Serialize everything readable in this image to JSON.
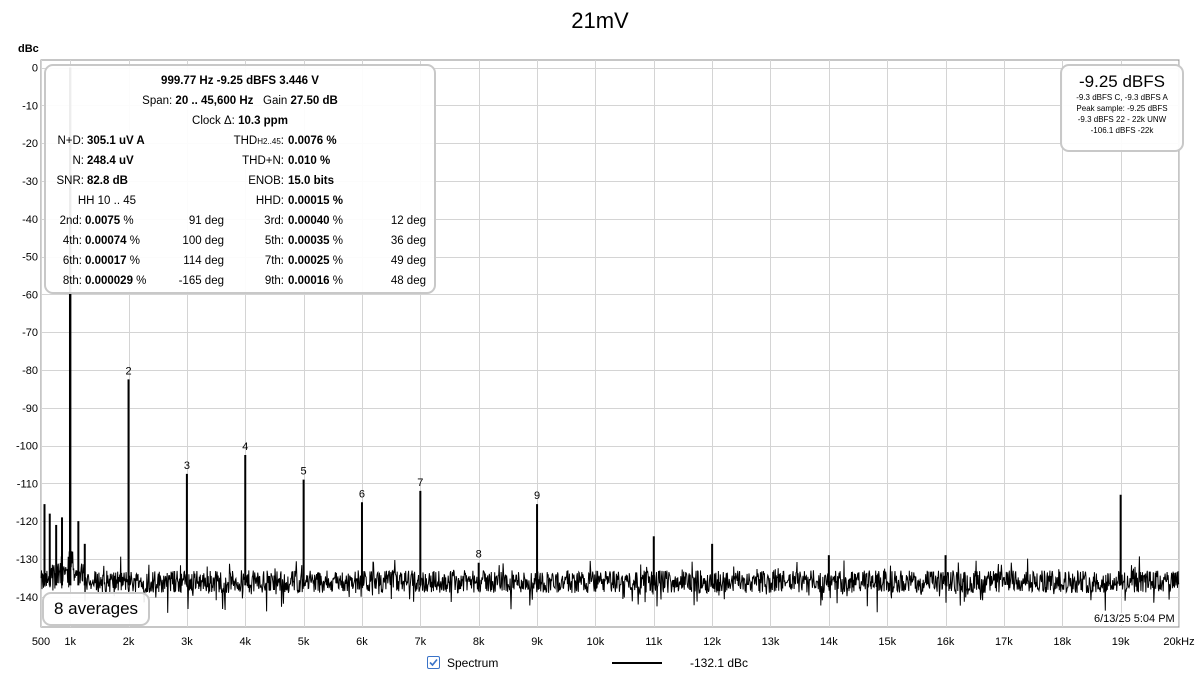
{
  "chart_data": {
    "type": "line",
    "title": "21mV",
    "ylabel": "dBc",
    "xlim": [
      500,
      20000
    ],
    "ylim": [
      -148,
      2
    ],
    "x_ticks": [
      {
        "value": 500,
        "label": "500"
      },
      {
        "value": 1000,
        "label": "1k"
      },
      {
        "value": 2000,
        "label": "2k"
      },
      {
        "value": 3000,
        "label": "3k"
      },
      {
        "value": 4000,
        "label": "4k"
      },
      {
        "value": 5000,
        "label": "5k"
      },
      {
        "value": 6000,
        "label": "6k"
      },
      {
        "value": 7000,
        "label": "7k"
      },
      {
        "value": 8000,
        "label": "8k"
      },
      {
        "value": 9000,
        "label": "9k"
      },
      {
        "value": 10000,
        "label": "10k"
      },
      {
        "value": 11000,
        "label": "11k"
      },
      {
        "value": 12000,
        "label": "12k"
      },
      {
        "value": 13000,
        "label": "13k"
      },
      {
        "value": 14000,
        "label": "14k"
      },
      {
        "value": 15000,
        "label": "15k"
      },
      {
        "value": 16000,
        "label": "16k"
      },
      {
        "value": 17000,
        "label": "17k"
      },
      {
        "value": 18000,
        "label": "18k"
      },
      {
        "value": 19000,
        "label": "19k"
      },
      {
        "value": 20000,
        "label": "20kHz"
      }
    ],
    "y_ticks": [
      {
        "value": 0,
        "label": "0"
      },
      {
        "value": -10,
        "label": "-10"
      },
      {
        "value": -20,
        "label": "-20"
      },
      {
        "value": -30,
        "label": "-30"
      },
      {
        "value": -40,
        "label": "-40"
      },
      {
        "value": -50,
        "label": "-50"
      },
      {
        "value": -60,
        "label": "-60"
      },
      {
        "value": -70,
        "label": "-70"
      },
      {
        "value": -80,
        "label": "-80"
      },
      {
        "value": -90,
        "label": "-90"
      },
      {
        "value": -100,
        "label": "-100"
      },
      {
        "value": -110,
        "label": "-110"
      },
      {
        "value": -120,
        "label": "-120"
      },
      {
        "value": -130,
        "label": "-130"
      },
      {
        "value": -140,
        "label": "-140"
      }
    ],
    "grid": true,
    "noise_floor_db": -136,
    "series": [
      {
        "name": "Spectrum",
        "color": "#000000",
        "peaks": [
          {
            "x": 1000,
            "y": 0
          },
          {
            "x": 2000,
            "y": -82.5,
            "label": "2"
          },
          {
            "x": 3000,
            "y": -107.5,
            "label": "3"
          },
          {
            "x": 4000,
            "y": -102.5,
            "label": "4"
          },
          {
            "x": 5000,
            "y": -109,
            "label": "5"
          },
          {
            "x": 6000,
            "y": -115,
            "label": "6"
          },
          {
            "x": 7000,
            "y": -112,
            "label": "7"
          },
          {
            "x": 8000,
            "y": -131,
            "label": "8"
          },
          {
            "x": 9000,
            "y": -115.5,
            "label": "9"
          },
          {
            "x": 11000,
            "y": -124
          },
          {
            "x": 12000,
            "y": -126
          },
          {
            "x": 14000,
            "y": -129
          },
          {
            "x": 16000,
            "y": -129
          },
          {
            "x": 19000,
            "y": -113
          },
          {
            "x": 560,
            "y": -115.5
          },
          {
            "x": 650,
            "y": -118
          },
          {
            "x": 760,
            "y": -121
          },
          {
            "x": 860,
            "y": -119
          },
          {
            "x": 1140,
            "y": -120
          },
          {
            "x": 1250,
            "y": -126
          }
        ]
      }
    ]
  },
  "stats": {
    "header_line": "999.77 Hz  -9.25 dBFS  3.446 V",
    "span_label": "Span:",
    "span_value": "20 .. 45,600 Hz",
    "gain_label": "Gain",
    "gain_value": "27.50 dB",
    "clock_label": "Clock Δ:",
    "clock_value": "10.3 ppm",
    "npd_label": "N+D:",
    "npd_value": "305.1 uV A",
    "thd_label": "THD",
    "thd_sub": "H2..45",
    "thd_label_end": ":",
    "thd_value": "0.0076 %",
    "n_label": "N:",
    "n_value": "248.4 uV",
    "thdn_label": "THD+N:",
    "thdn_value": "0.010 %",
    "snr_label": "SNR:",
    "snr_value": "82.8 dB",
    "enob_label": "ENOB:",
    "enob_value": "15.0 bits",
    "hh_label": "HH 10 .. 45",
    "hhd_label": "HHD:",
    "hhd_value": "0.00015 %",
    "harmonics": [
      {
        "left_label": "2nd:",
        "left_value": "0.0075",
        "left_unit": " %",
        "left_deg": "91 deg",
        "right_label": "3rd:",
        "right_value": "0.00040",
        "right_unit": " %",
        "right_deg": "12 deg"
      },
      {
        "left_label": "4th:",
        "left_value": "0.00074",
        "left_unit": " %",
        "left_deg": "100 deg",
        "right_label": "5th:",
        "right_value": "0.00035",
        "right_unit": " %",
        "right_deg": "36 deg"
      },
      {
        "left_label": "6th:",
        "left_value": "0.00017",
        "left_unit": " %",
        "left_deg": "114 deg",
        "right_label": "7th:",
        "right_value": "0.00025",
        "right_unit": " %",
        "right_deg": "49 deg"
      },
      {
        "left_label": "8th:",
        "left_value": "0.000029",
        "left_unit": " %",
        "left_deg": "-165 deg",
        "right_label": "9th:",
        "right_value": "0.00016",
        "right_unit": " %",
        "right_deg": "48 deg"
      }
    ]
  },
  "level": {
    "main": "-9.25 dBFS",
    "lines": [
      "-9.3 dBFS C, -9.3 dBFS A",
      "Peak sample: -9.25 dBFS",
      "-9.3 dBFS 22 - 22k UNW",
      "-106.1 dBFS -22k"
    ]
  },
  "averages_label": "8 averages",
  "timestamp": "6/13/25 5:04 PM",
  "legend": {
    "checked": true,
    "label": "Spectrum",
    "value": "-132.1 dBc"
  },
  "colors": {
    "grid": "#d4d4d4",
    "axis": "#8c8c8c",
    "trace": "#000000",
    "checkbox": "#3a73c8"
  }
}
